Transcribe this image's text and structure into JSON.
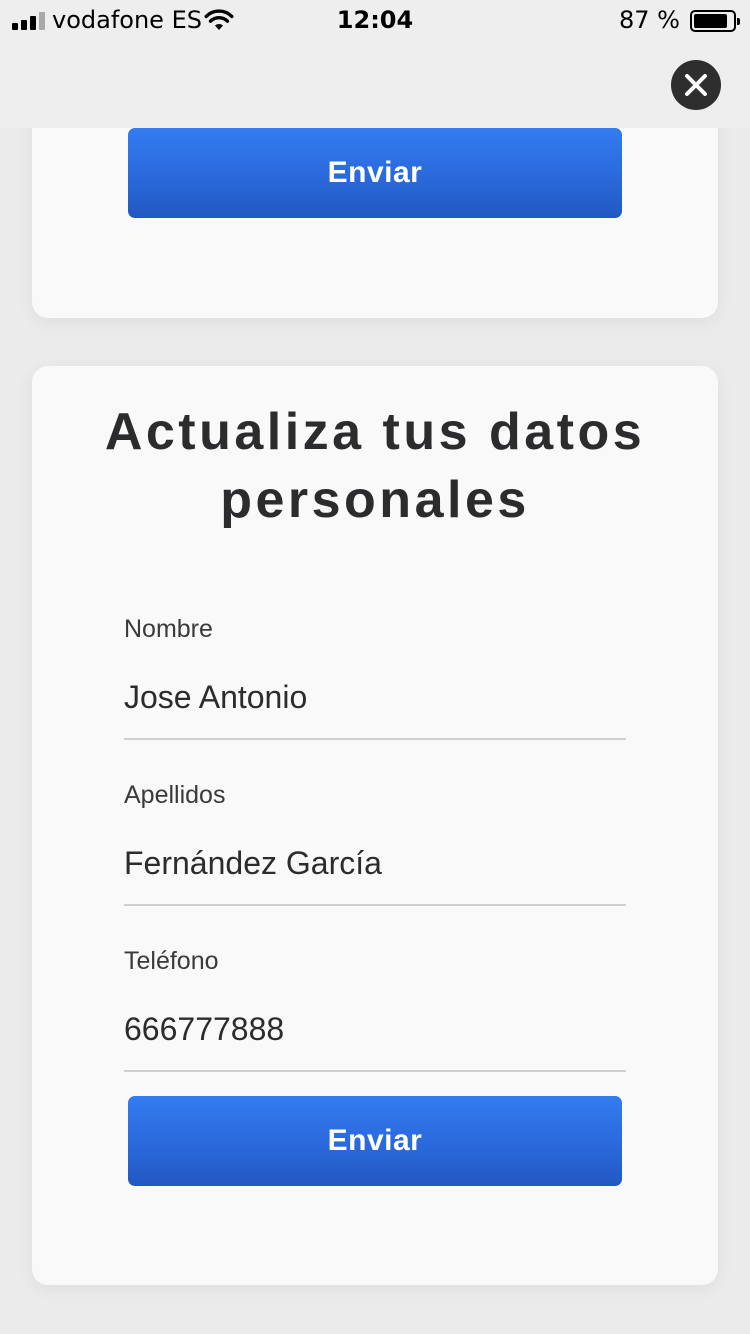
{
  "status_bar": {
    "carrier": "vodafone ES",
    "time": "12:04",
    "battery_percent": "87 %",
    "battery_level": 0.87,
    "signal_bars_active": 3,
    "signal_bars_total": 4
  },
  "top_bar": {
    "close_icon": "close-icon"
  },
  "previous_form": {
    "submit_label": "Enviar"
  },
  "personal_data_form": {
    "title_line1": "Actualiza tus datos",
    "title_line2": "personales",
    "fields": [
      {
        "label": "Nombre",
        "value": "Jose Antonio"
      },
      {
        "label": "Apellidos",
        "value": "Fernández García"
      },
      {
        "label": "Teléfono",
        "value": "666777888"
      }
    ],
    "submit_label": "Enviar"
  },
  "colors": {
    "primary_button": "#2a69db",
    "card_background": "#f9f9f9",
    "page_background": "#ebebeb",
    "close_button": "#2e2e2e"
  }
}
